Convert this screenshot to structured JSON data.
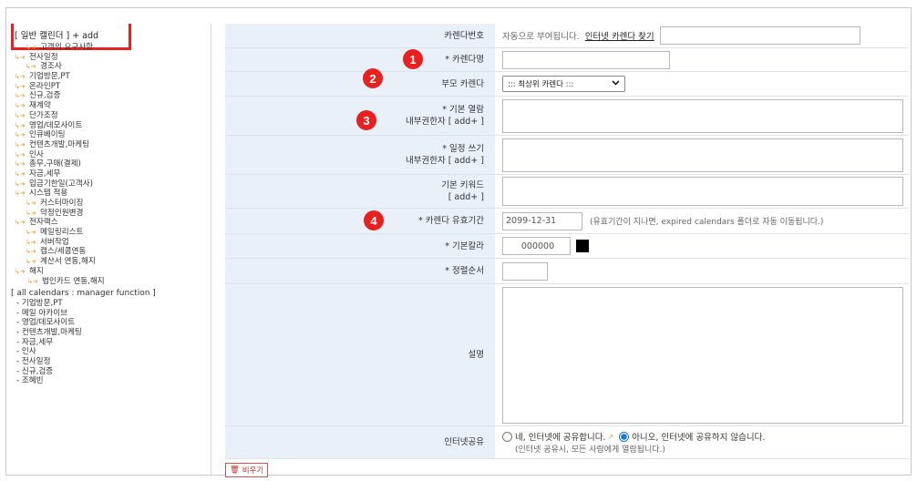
{
  "tree": {
    "header": "[ 일반 캘린더 ] + add",
    "items": [
      {
        "label": "고객의 요구사항",
        "level": 2
      },
      {
        "label": "전사일정",
        "level": 1
      },
      {
        "label": "경조사",
        "level": 2
      },
      {
        "label": "기업방문,PT",
        "level": 1
      },
      {
        "label": "온라인PT",
        "level": 1
      },
      {
        "label": "신규,검증",
        "level": 1
      },
      {
        "label": "재계약",
        "level": 1
      },
      {
        "label": "단가조정",
        "level": 1
      },
      {
        "label": "영업/데모사이트",
        "level": 1
      },
      {
        "label": "인큐베이팅",
        "level": 1
      },
      {
        "label": "컨텐츠개발,마케팅",
        "level": 1
      },
      {
        "label": "인사",
        "level": 1
      },
      {
        "label": "총무,구매(결제)",
        "level": 1
      },
      {
        "label": "자금,세무",
        "level": 1
      },
      {
        "label": "입금기한일(고객사)",
        "level": 1
      },
      {
        "label": "시스템 적용",
        "level": 1
      },
      {
        "label": "커스터마이징",
        "level": 2
      },
      {
        "label": "약정인원변경",
        "level": 2
      },
      {
        "label": "전자랙스",
        "level": 1
      },
      {
        "label": "메일링리스트",
        "level": 2
      },
      {
        "label": "서버작업",
        "level": 2
      },
      {
        "label": "캡스/세콤연동",
        "level": 2
      },
      {
        "label": "계산서 연동,해지",
        "level": 2
      },
      {
        "label": "해지",
        "level": 1
      },
      {
        "label": "법인카드 연동,해지",
        "level": 3
      }
    ],
    "section2": "[ all calendars : manager function ]",
    "items2": [
      "기업방문,PT",
      "메일 아카이브",
      "영업/데모사이트",
      "컨텐츠개발,마케팅",
      "자금,세무",
      "인사",
      "전사일정",
      "신규,검증",
      "조혜빈"
    ]
  },
  "form": {
    "calendar_no_label": "카렌다번호",
    "calendar_no_text": "자동으로 부여됩니다.",
    "internet_find_link": "인터넷 카렌다 찾기",
    "name_label": "* 카렌다명",
    "parent_label": "부모 카렌다",
    "parent_selected": "::: 최상위 카렌다 :::",
    "view_label_1": "* 기본 열람",
    "view_label_2": "내부권한자 [ add+ ]",
    "write_label_1": "* 일정 쓰기",
    "write_label_2": "내부권한자 [ add+ ]",
    "keyword_label_1": "기본 키워드",
    "keyword_label_2": "[ add+ ]",
    "expiry_label": "* 카렌다 유효기간",
    "expiry_value": "2099-12-31",
    "expiry_note": "(유효기간이 지나면, expired calendars 폴더로 자동 이동됩니다.)",
    "color_label": "* 기본칼라",
    "color_value": "000000",
    "color_hex": "#000000",
    "order_label": "* 정렬순서",
    "desc_label": "설명",
    "share_label": "인터넷공유",
    "share_yes": "네, 인터넷에 공유합니다.",
    "share_no": "아니오, 인터넷에 공유하지 않습니다.",
    "share_note": "(인터넷 공유시, 모든 사람에게 열람됩니다.)",
    "share_selected": "no"
  },
  "badges": [
    "1",
    "2",
    "3",
    "4"
  ],
  "bottom_button": "비우기",
  "accent": "#e8201f"
}
